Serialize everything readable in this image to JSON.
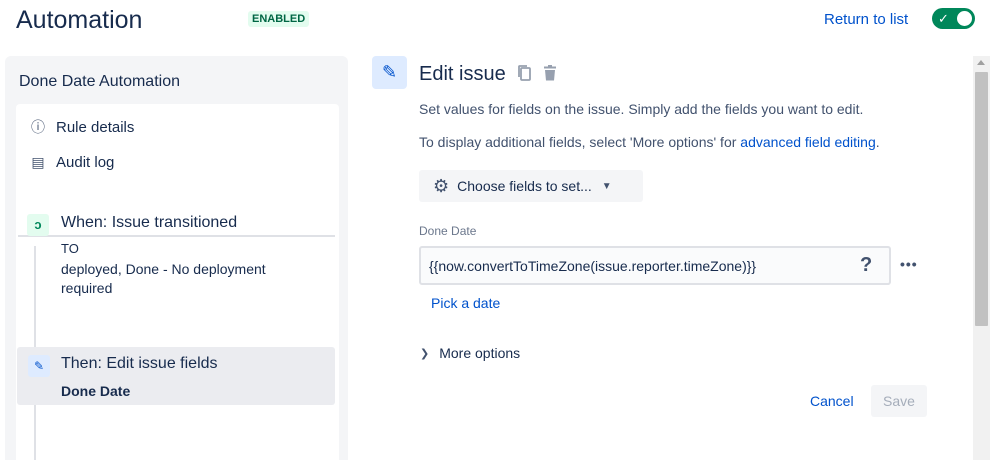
{
  "header": {
    "title": "Automation",
    "status": "ENABLED",
    "return_link": "Return to list",
    "toggle_check": "✓"
  },
  "sidebar": {
    "rule_name": "Done Date Automation",
    "items": [
      {
        "icon": "info-icon",
        "glyph": "ⓘ",
        "label": "Rule details"
      },
      {
        "icon": "document-icon",
        "glyph": "▤",
        "label": "Audit log"
      }
    ],
    "trigger": {
      "icon": "branch-icon",
      "glyph": "ↄ",
      "title": "When: Issue transitioned",
      "label": "TO",
      "detail": "deployed, Done - No deployment required"
    },
    "action": {
      "icon": "pencil-icon",
      "glyph": "✎",
      "title": "Then: Edit issue fields",
      "subtitle": "Done Date"
    }
  },
  "editor": {
    "icon_glyph": "✎",
    "title": "Edit issue",
    "description": "Set values for fields on the issue. Simply add the fields you want to edit.",
    "description2_prefix": "To display additional fields, select 'More options' for ",
    "description2_link": "advanced field editing",
    "description2_suffix": ".",
    "choose_fields_label": "Choose fields to set...",
    "gear_glyph": "⚙",
    "chevron_glyph": "▼",
    "field": {
      "label": "Done Date",
      "value": "{{now.convertToTimeZone(issue.reporter.timeZone)}}",
      "help_glyph": "?",
      "more_glyph": "•••"
    },
    "pick_date_label": "Pick a date",
    "more_options_label": "More options",
    "more_options_chevron": "❯",
    "cancel_label": "Cancel",
    "save_label": "Save"
  },
  "colors": {
    "accent": "#0052cc",
    "enabled_bg": "#e3fcef",
    "enabled_text": "#006644",
    "toggle_on": "#00875a"
  }
}
